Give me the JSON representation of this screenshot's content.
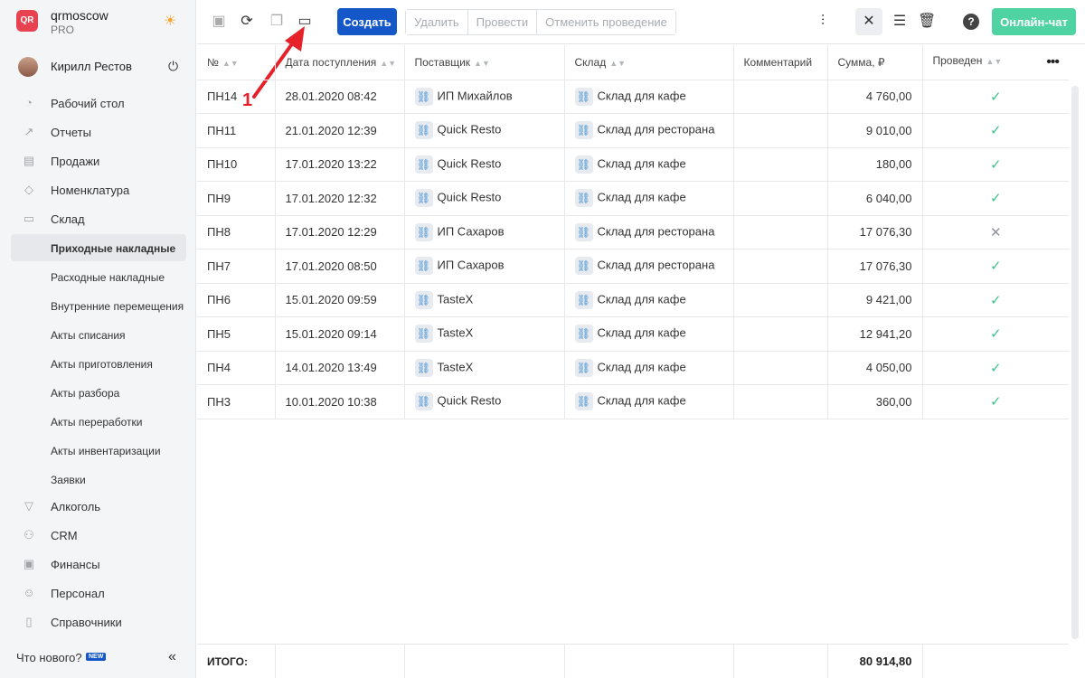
{
  "brand": {
    "name": "qrmoscow",
    "plan": "PRO",
    "logo_text": "QR"
  },
  "user": {
    "name": "Кирилл Рестов"
  },
  "nav": [
    {
      "label": "Рабочий стол",
      "icon": "gauge-icon"
    },
    {
      "label": "Отчеты",
      "icon": "chart-icon"
    },
    {
      "label": "Продажи",
      "icon": "basket-icon"
    },
    {
      "label": "Номенклатура",
      "icon": "tag-icon"
    },
    {
      "label": "Склад",
      "icon": "box-icon"
    }
  ],
  "warehouse_sub": [
    "Приходные накладные",
    "Расходные накладные",
    "Внутренние перемещения",
    "Акты списания",
    "Акты приготовления",
    "Акты разбора",
    "Акты переработки",
    "Акты инвентаризации",
    "Заявки"
  ],
  "nav_bottom": [
    {
      "label": "Алкоголь",
      "icon": "glass-icon"
    },
    {
      "label": "CRM",
      "icon": "people-icon"
    },
    {
      "label": "Финансы",
      "icon": "wallet-icon"
    },
    {
      "label": "Персонал",
      "icon": "staff-icon"
    },
    {
      "label": "Справочники",
      "icon": "book-icon"
    }
  ],
  "whats_new": "Что нового?",
  "new_badge": "NEW",
  "toolbar": {
    "create": "Создать",
    "delete": "Удалить",
    "post": "Провести",
    "unpost": "Отменить проведение",
    "chat": "Онлайн-чат"
  },
  "annotation": "1",
  "columns": [
    "№",
    "Дата поступления",
    "Поставщик",
    "Склад",
    "Комментарий",
    "Сумма, ₽",
    "Проведен"
  ],
  "rows": [
    {
      "no": "ПН14",
      "date": "28.01.2020 08:42",
      "supplier": "ИП Михайлов",
      "store": "Склад для кафе",
      "comment": "",
      "sum": "4 760,00",
      "posted": true
    },
    {
      "no": "ПН11",
      "date": "21.01.2020 12:39",
      "supplier": "Quick Resto",
      "store": "Склад для ресторана",
      "comment": "",
      "sum": "9 010,00",
      "posted": true
    },
    {
      "no": "ПН10",
      "date": "17.01.2020 13:22",
      "supplier": "Quick Resto",
      "store": "Склад для кафе",
      "comment": "",
      "sum": "180,00",
      "posted": true
    },
    {
      "no": "ПН9",
      "date": "17.01.2020 12:32",
      "supplier": "Quick Resto",
      "store": "Склад для кафе",
      "comment": "",
      "sum": "6 040,00",
      "posted": true
    },
    {
      "no": "ПН8",
      "date": "17.01.2020 12:29",
      "supplier": "ИП Сахаров",
      "store": "Склад для ресторана",
      "comment": "",
      "sum": "17 076,30",
      "posted": false
    },
    {
      "no": "ПН7",
      "date": "17.01.2020 08:50",
      "supplier": "ИП Сахаров",
      "store": "Склад для ресторана",
      "comment": "",
      "sum": "17 076,30",
      "posted": true
    },
    {
      "no": "ПН6",
      "date": "15.01.2020 09:59",
      "supplier": "TasteX",
      "store": "Склад для кафе",
      "comment": "",
      "sum": "9 421,00",
      "posted": true
    },
    {
      "no": "ПН5",
      "date": "15.01.2020 09:14",
      "supplier": "TasteX",
      "store": "Склад для кафе",
      "comment": "",
      "sum": "12 941,20",
      "posted": true
    },
    {
      "no": "ПН4",
      "date": "14.01.2020 13:49",
      "supplier": "TasteX",
      "store": "Склад для кафе",
      "comment": "",
      "sum": "4 050,00",
      "posted": true
    },
    {
      "no": "ПН3",
      "date": "10.01.2020 10:38",
      "supplier": "Quick Resto",
      "store": "Склад для кафе",
      "comment": "",
      "sum": "360,00",
      "posted": true
    }
  ],
  "footer": {
    "label": "ИТОГО:",
    "total": "80 914,80"
  },
  "colors": {
    "primary": "#1457c8",
    "chat": "#4fd3a3",
    "check": "#3ec48c",
    "annotation": "#e6212a"
  }
}
